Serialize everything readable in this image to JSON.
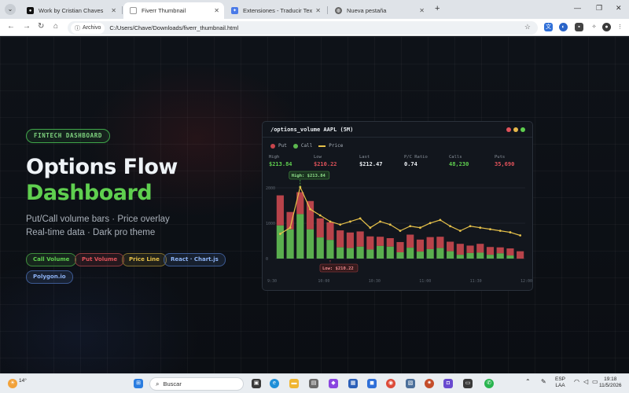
{
  "browser": {
    "tabs": [
      {
        "title": "Work by Cristian Chaves",
        "active": false
      },
      {
        "title": "Fiverr Thumbnail",
        "active": true
      },
      {
        "title": "Extensiones - Traducir Texto Se",
        "active": false
      },
      {
        "title": "Nueva pestaña",
        "active": false
      }
    ],
    "address_chip": "Archivo",
    "url": "C:/Users/Chave/Downloads/fiverr_thumbnail.html"
  },
  "hero": {
    "badge": "FINTECH DASHBOARD",
    "title_line1": "Options Flow",
    "title_line2": "Dashboard",
    "subtitle_line1": "Put/Call volume bars · Price overlay",
    "subtitle_line2": "Real-time data · Dark pro theme",
    "pills": [
      {
        "label": "Call Volume",
        "color": "#5fcf4f"
      },
      {
        "label": "Put Volume",
        "color": "#e0525a"
      },
      {
        "label": "Price Line",
        "color": "#e6c14a"
      },
      {
        "label": "React · Chart.js",
        "color": "#6f9cf0"
      },
      {
        "label": "Polygon.io",
        "color": "#6f9cf0"
      }
    ]
  },
  "card": {
    "title": "/options_volume AAPL (5M)",
    "legend": [
      {
        "label": "Put",
        "color": "#c8454c"
      },
      {
        "label": "Call",
        "color": "#5cb84f"
      },
      {
        "label": "Price",
        "color": "#e6c14a"
      }
    ],
    "stats": [
      {
        "label": "High",
        "value": "$213.84",
        "color": "#5fcf4f"
      },
      {
        "label": "Low",
        "value": "$210.22",
        "color": "#e0525a"
      },
      {
        "label": "Last",
        "value": "$212.47",
        "color": "#eef2f6"
      },
      {
        "label": "P/C Ratio",
        "value": "0.74",
        "color": "#eef2f6"
      },
      {
        "label": "Calls",
        "value": "48,230",
        "color": "#5fcf4f"
      },
      {
        "label": "Puts",
        "value": "35,690",
        "color": "#e0525a"
      }
    ],
    "annotations": {
      "high": "High: $213.84",
      "low": "Low: $210.22"
    }
  },
  "chart_data": {
    "type": "bar",
    "x_ticks": [
      "9:30",
      "10:00",
      "10:30",
      "11:00",
      "11:30",
      "12:00"
    ],
    "y_ticks": [
      "2000",
      "1000",
      "0"
    ],
    "series": [
      {
        "name": "Call",
        "values": [
          1160,
          1050,
          1480,
          1050,
          820,
          750,
          540,
          520,
          560,
          480,
          580,
          560,
          400,
          530,
          420,
          490,
          520,
          430,
          330,
          380,
          390,
          330,
          370,
          310,
          220
        ]
      },
      {
        "name": "Put",
        "values": [
          850,
          490,
          620,
          800,
          540,
          500,
          480,
          440,
          430,
          370,
          260,
          240,
          290,
          370,
          340,
          340,
          320,
          270,
          310,
          210,
          250,
          220,
          170,
          200,
          210
        ]
      },
      {
        "name": "Price",
        "values": [
          210.8,
          211.2,
          213.84,
          212.4,
          212.0,
          211.6,
          211.4,
          211.6,
          211.8,
          211.2,
          211.6,
          211.4,
          211.0,
          211.3,
          211.2,
          211.5,
          211.7,
          211.3,
          211.0,
          211.3,
          211.2,
          211.1,
          211.0,
          210.9,
          210.7
        ]
      }
    ],
    "ylim": [
      0,
      2400
    ]
  },
  "taskbar": {
    "weather": "14°",
    "search_placeholder": "Buscar",
    "lang_line1": "ESP",
    "lang_line2": "LAA",
    "time": "19:18",
    "date": "11/5/2026"
  }
}
